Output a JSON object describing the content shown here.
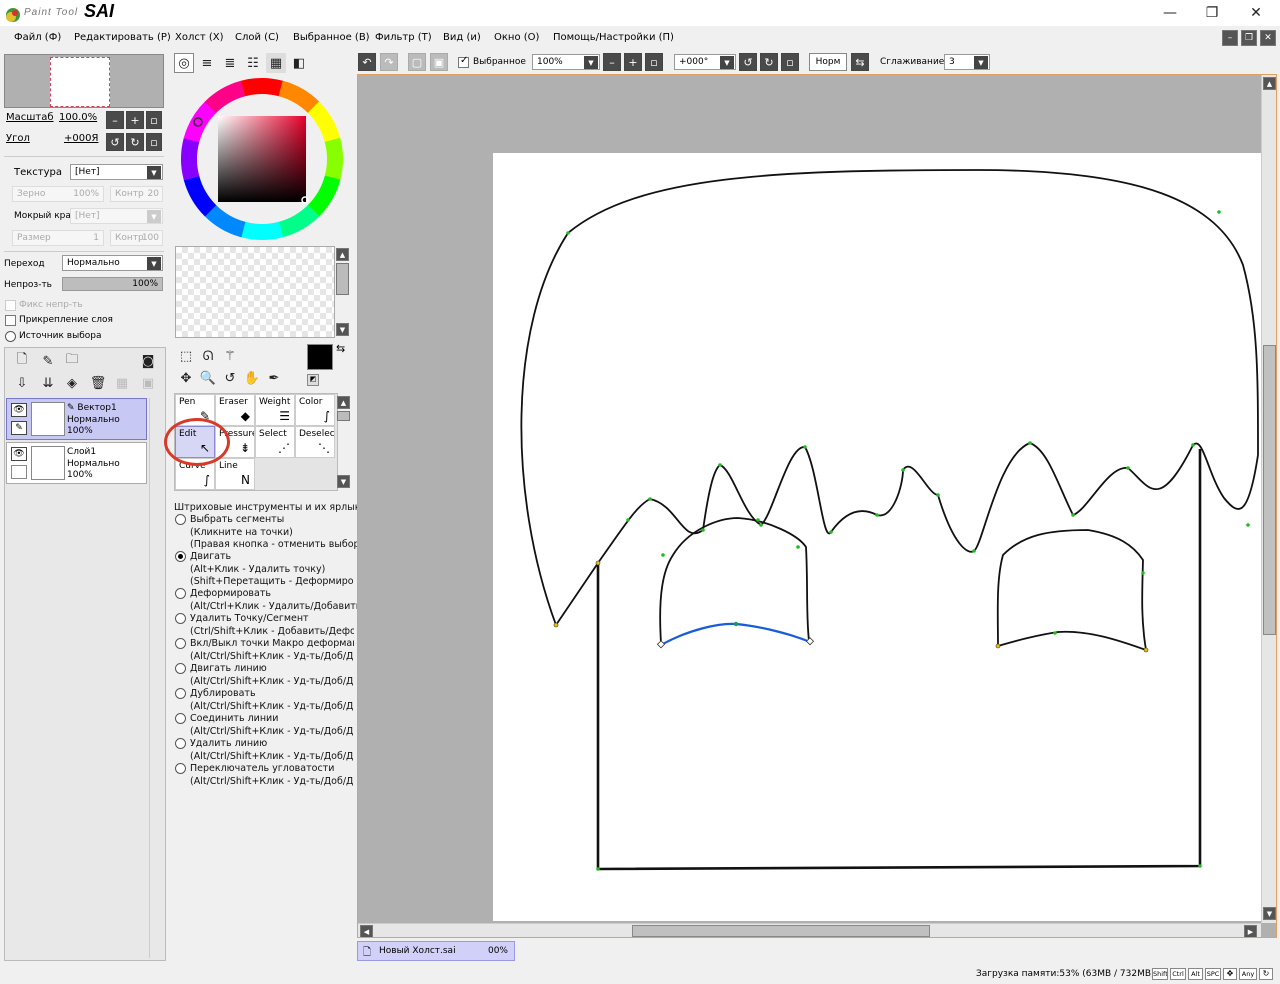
{
  "app": {
    "logo_small": "Paint Tool",
    "logo_big": "SAI"
  },
  "window_controls": {
    "minimize": "—",
    "maximize": "❐",
    "close": "✕"
  },
  "menu": [
    "Файл (Ф)",
    "Редактировать (Р)",
    "Холст (Х)",
    "Слой (С)",
    "Выбранное (В)",
    "Фильтр (Т)",
    "Вид (и)",
    "Окно (О)",
    "Помощь/Настройки (П)"
  ],
  "navigator": {
    "zoom_label": "Масштаб",
    "zoom_value": "100.0%",
    "angle_label": "Угол",
    "angle_value": "+000Я"
  },
  "brush_settings": {
    "texture_label": "Текстура",
    "texture_value": "[Нет]",
    "grain_label": "Зерно",
    "grain_value": "100%",
    "contrast_label": "Контр",
    "contrast_value": "20",
    "wet_edge_label": "Мокрый край",
    "wet_edge_value": "[Нет]",
    "size_label": "Размер",
    "size_value": "1",
    "contrast2_label": "Контр",
    "contrast2_value": "100"
  },
  "layer_props": {
    "blend_label": "Переход",
    "blend_value": "Нормально",
    "opacity_label": "Непроз-ть",
    "opacity_value": "100%",
    "fix_opacity_label": "Фикс непр-ть",
    "clip_label": "Прикрепление слоя",
    "sel_source_label": "Источник выбора"
  },
  "layers": [
    {
      "name": "Вектор1",
      "mode": "Нормально",
      "opacity": "100%",
      "selected": true
    },
    {
      "name": "Слой1",
      "mode": "Нормально",
      "opacity": "100%",
      "selected": false
    }
  ],
  "tools": [
    {
      "label": "Pen",
      "icon": "✎"
    },
    {
      "label": "Eraser",
      "icon": "◆"
    },
    {
      "label": "Weight",
      "icon": "☰"
    },
    {
      "label": "Color",
      "icon": "∫"
    },
    {
      "label": "Edit",
      "icon": "↖",
      "selected": true
    },
    {
      "label": "Pressure",
      "icon": "⇟"
    },
    {
      "label": "Select",
      "icon": "⋰"
    },
    {
      "label": "Deselect",
      "icon": "⋱"
    },
    {
      "label": "Curve",
      "icon": "∫"
    },
    {
      "label": "Line",
      "icon": "N"
    }
  ],
  "edit_options": {
    "title": "Штриховые инструменты и их ярлыки",
    "items": [
      {
        "label": "Выбрать сегменты",
        "hints": [
          "(Кликните на точки)",
          "(Правая кнопка - отменить выбор)"
        ],
        "checked": false
      },
      {
        "label": "Двигать",
        "hints": [
          "(Alt+Клик - Удалить точку)",
          "(Shift+Перетащить - Деформировать)"
        ],
        "checked": true
      },
      {
        "label": "Деформировать",
        "hints": [
          "(Alt/Ctrl+Клик - Удалить/Добавить)"
        ],
        "checked": false
      },
      {
        "label": "Удалить Точку/Сегмент",
        "hints": [
          "(Ctrl/Shift+Клик - Добавить/Деформировать)"
        ],
        "checked": false
      },
      {
        "label": "Вкл/Выкл точки Макро деформации",
        "hints": [
          "(Alt/Ctrl/Shift+Клик - Уд-ть/Доб/Деф-ть)"
        ],
        "checked": false
      },
      {
        "label": "Двигать линию",
        "hints": [
          "(Alt/Ctrl/Shift+Клик - Уд-ть/Доб/Деф-ть)"
        ],
        "checked": false
      },
      {
        "label": "Дублировать",
        "hints": [
          "(Alt/Ctrl/Shift+Клик - Уд-ть/Доб/Деф-ть)"
        ],
        "checked": false
      },
      {
        "label": "Соединить линии",
        "hints": [
          "(Alt/Ctrl/Shift+Клик - Уд-ть/Доб/Деф-ть)"
        ],
        "checked": false
      },
      {
        "label": "Удалить линию",
        "hints": [
          "(Alt/Ctrl/Shift+Клик - Уд-ть/Доб/Деф-ть)"
        ],
        "checked": false
      },
      {
        "label": "Переключатель угловатости",
        "hints": [
          "(Alt/Ctrl/Shift+Клик - Уд-ть/Доб/Деф-ть)"
        ],
        "checked": false
      }
    ]
  },
  "toolbar": {
    "selection_label": "Выбранное",
    "zoom_value": "100%",
    "angle_value": "+000°",
    "mode_button": "Норм",
    "smoothing_label": "Сглаживание",
    "smoothing_value": "3"
  },
  "document_tab": {
    "name": "Новый Холст.sai",
    "zoom": "00%"
  },
  "status": {
    "memory": "Загрузка памяти:53% (63MB / 732MB)",
    "keys": [
      "Shift",
      "Ctrl",
      "Alt",
      "SPC",
      "✥",
      "Any",
      "↻"
    ]
  },
  "colors": {
    "accent_select": "#c8c8f5",
    "vector_highlight": "#1a5cd8",
    "annotation_circle": "#d83a2a"
  }
}
